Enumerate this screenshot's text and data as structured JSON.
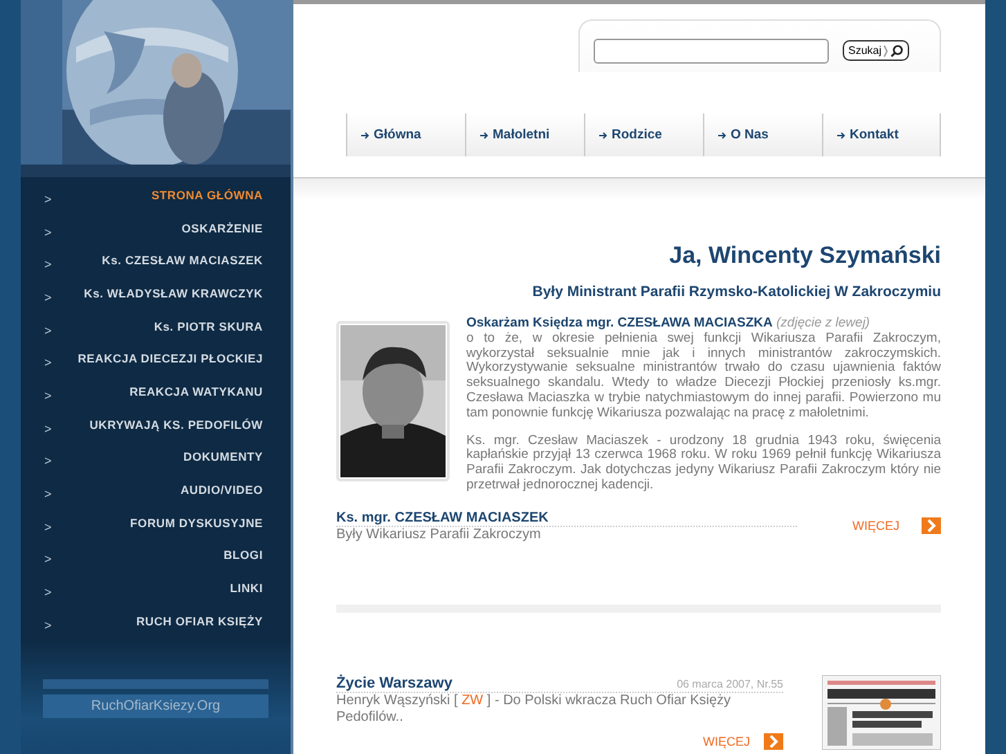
{
  "sidebar": {
    "menu": [
      {
        "label": "STRONA GŁÓWNA",
        "selected": true
      },
      {
        "label": "OSKARŻENIE",
        "selected": false
      },
      {
        "label": "Ks. CZESŁAW MACIASZEK",
        "selected": false
      },
      {
        "label": "Ks. WŁADYSŁAW KRAWCZYK",
        "selected": false
      },
      {
        "label": "Ks. PIOTR SKURA",
        "selected": false
      },
      {
        "label": "REAKCJA DIECEZJI PŁOCKIEJ",
        "selected": false
      },
      {
        "label": "REAKCJA WATYKANU",
        "selected": false
      },
      {
        "label": "UKRYWAJĄ KS. PEDOFILÓW",
        "selected": false
      },
      {
        "label": "DOKUMENTY",
        "selected": false
      },
      {
        "label": "AUDIO/VIDEO",
        "selected": false
      },
      {
        "label": "FORUM DYSKUSYJNE",
        "selected": false
      },
      {
        "label": "BLOGI",
        "selected": false
      },
      {
        "label": "LINKI",
        "selected": false
      },
      {
        "label": "RUCH OFIAR KSIĘŻY",
        "selected": false
      }
    ],
    "marker": ">",
    "site_link": "RuchOfiarKsiezy.Org"
  },
  "search": {
    "button": "Szukaj"
  },
  "tabs": [
    {
      "label": "Główna"
    },
    {
      "label": "Małoletni"
    },
    {
      "label": "Rodzice"
    },
    {
      "label": "O Nas"
    },
    {
      "label": "Kontakt"
    }
  ],
  "article": {
    "title": "Ja, Wincenty Szymański",
    "subtitle": "Były Ministrant Parafii Rzymsko-Katolickiej W Zakroczymiu",
    "lead": "**Oskarżam Księdza mgr. CZESŁAWA MACIASZKA** *(zdjęcie z lewej)*",
    "paragraphs": [
      "o to że, w okresie pełnienia swej funkcji Wikariusza Parafii Zakroczym, wykorzystał seksualnie mnie jak i innych ministrantów zakroczymskich. Wykorzystywanie seksualne ministrantów trwało do czasu ujawnienia faktów seksualnego skandalu. Wtedy to władze Diecezji Płockiej przeniosły ks.mgr. Czesława Maciaszka w trybie natychmiastowym do innej parafii. Powierzono mu tam ponownie funkcję Wikariusza pozwalając na pracę z małoletnimi.",
      "Ks. mgr. Czesław Maciaszek - urodzony 18 grudnia 1943 roku, święcenia kapłańskie przyjął 13 czerwca 1968 roku. W roku 1969 pełnił funkcję Wikariusza Parafii Zakroczym. Jak dotychczas jedyny Wikariusz Parafii Zakroczym który nie przetrwał jednorocznej kadencji."
    ],
    "person": {
      "name": "Ks. mgr. CZESŁAW MACIASZEK",
      "role": "Były Wikariusz Parafii Zakroczym",
      "more": "WIĘCEJ"
    }
  },
  "news": {
    "source": "Życie Warszawy",
    "date": "06 marca 2007, Nr.55",
    "author": "Henryk Wąszyński [",
    "tag": "ZW",
    "text": "] -  Do Polski wkracza Ruch Ofiar Księży Pedofilów..",
    "more": "WIĘCEJ"
  }
}
